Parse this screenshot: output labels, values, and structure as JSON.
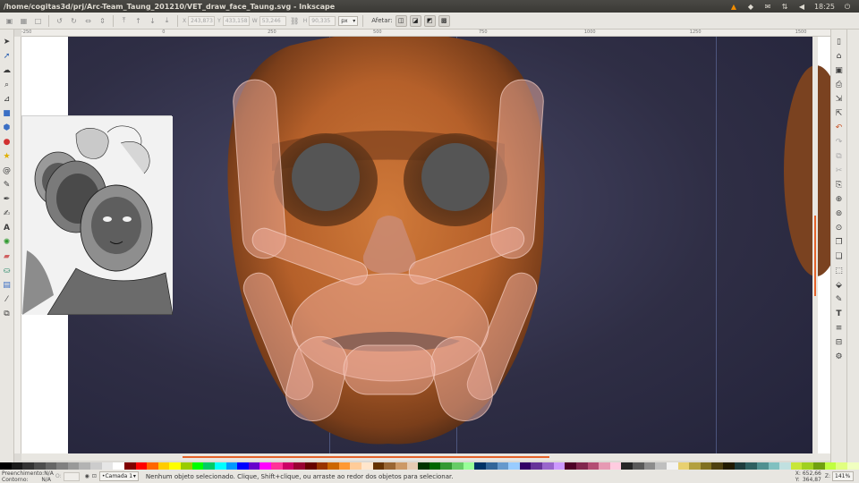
{
  "window": {
    "title": "/home/cogitas3d/prj/Arc-Team_Taung_201210/VET_draw_face_Taung.svg - Inkscape",
    "clock": "18:25",
    "tray_icons": [
      "vlc-icon",
      "dropbox-icon",
      "mail-icon",
      "network-icon",
      "volume-icon",
      "clock-text",
      "power-icon"
    ]
  },
  "toolbar": {
    "x_label": "X",
    "x_value": "243,873",
    "y_label": "Y",
    "y_value": "433,158",
    "w_label": "W",
    "w_value": "53,246",
    "h_label": "H",
    "h_value": "90,335",
    "unit": "px",
    "affect_label": "Afetar:"
  },
  "ruler": {
    "ticks": [
      "-250",
      "",
      "",
      "",
      "0",
      "",
      "",
      "250",
      "",
      "",
      "500",
      "",
      "",
      "750",
      "",
      "",
      "1000",
      "",
      "",
      "1250",
      "",
      "",
      "1500"
    ]
  },
  "status": {
    "fill_label": "Preenchimento:",
    "fill_value": "N/A",
    "stroke_label": "Contorno:",
    "stroke_value": "N/A",
    "opacity_label": "O:",
    "layer": "•Camada 1",
    "message": "Nenhum objeto selecionado. Clique, Shift+clique, ou arraste ao redor dos objetos para selecionar.",
    "x_label": "X:",
    "x_value": "652,66",
    "y_label": "Y:",
    "y_value": "364,87",
    "zoom_label": "Z:",
    "zoom_value": "141%"
  },
  "palette": [
    "#000000",
    "#1a1a1a",
    "#333333",
    "#4d4d4d",
    "#666666",
    "#808080",
    "#999999",
    "#b3b3b3",
    "#cccccc",
    "#e6e6e6",
    "#ffffff",
    "#800000",
    "#ff0000",
    "#ff6600",
    "#ffcc00",
    "#ffff00",
    "#99cc00",
    "#00ff00",
    "#00cc66",
    "#00ffff",
    "#0099ff",
    "#0000ff",
    "#6600cc",
    "#ff00ff",
    "#ff3399",
    "#cc0066",
    "#990033",
    "#660000",
    "#993300",
    "#cc6600",
    "#ff9933",
    "#ffcc99",
    "#ffe6cc",
    "#663300",
    "#996633",
    "#cc9966",
    "#e6ccb3",
    "#003300",
    "#006600",
    "#339933",
    "#66cc66",
    "#99ff99",
    "#003366",
    "#336699",
    "#6699cc",
    "#99ccff",
    "#330066",
    "#663399",
    "#9966cc",
    "#cc99ff",
    "#4d0026",
    "#80264d",
    "#b34d73",
    "#e699b3",
    "#ffcce0",
    "#262626",
    "#595959",
    "#8c8c8c",
    "#bfbfbf",
    "#f2f2f2",
    "#e8d070",
    "#b3a040",
    "#807020",
    "#4d4010",
    "#201a00",
    "#1e3c3c",
    "#2e6060",
    "#509090",
    "#80c0c0",
    "#c0e0e0",
    "#c8e638",
    "#a0d020",
    "#70a010",
    "#c0ff40",
    "#e0ff80",
    "#f0ffc0"
  ]
}
